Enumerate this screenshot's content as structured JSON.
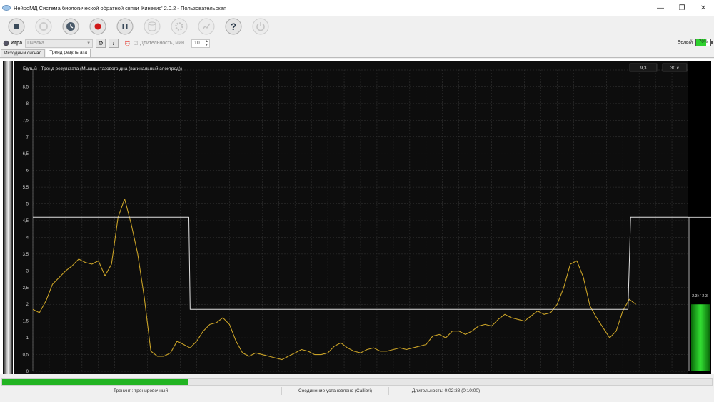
{
  "window": {
    "title": "НейроМД Система биологической обратной связи 'Кинезис' 2.0.2 - Пользовательская",
    "minimize": "—",
    "restore": "❐",
    "close": "✕"
  },
  "toolbar": {
    "buttons": [
      {
        "name": "stop",
        "icon": "stop-icon"
      },
      {
        "name": "disabled-record",
        "icon": "disc-icon"
      },
      {
        "name": "timer",
        "icon": "clock-icon"
      },
      {
        "name": "record",
        "icon": "record-icon"
      },
      {
        "name": "pause",
        "icon": "pause-icon"
      },
      {
        "name": "database",
        "icon": "database-icon"
      },
      {
        "name": "settings",
        "icon": "gear-icon"
      },
      {
        "name": "chart",
        "icon": "chart-icon"
      },
      {
        "name": "help",
        "icon": "help-icon",
        "label": "?"
      },
      {
        "name": "power",
        "icon": "power-icon"
      }
    ]
  },
  "options": {
    "game_label": "Игра",
    "game_value": "Пчёлка",
    "info_label": "i",
    "duration_label": "Длительность, мин.",
    "duration_value": "10",
    "user_label": "Белый",
    "battery_percent": "70%",
    "battery_level": 0.7
  },
  "tabs": [
    {
      "label": "Исходный сигнал",
      "active": false
    },
    {
      "label": "Тренд результата",
      "active": true
    }
  ],
  "plot": {
    "title": "Белый - Тренд результата (Мышцы тазового дна (вагинальный электрод))",
    "readout_value": "9,3",
    "readout_time": "30 с",
    "range_label": "2.3+/-2.3",
    "meter_level": 2.0
  },
  "chart_data": {
    "type": "line",
    "ylim": [
      0,
      9
    ],
    "xlim": [
      0,
      100
    ],
    "yticks": [
      "0",
      "0,5",
      "1",
      "1,5",
      "2",
      "2,5",
      "3",
      "3,5",
      "4",
      "4,5",
      "5",
      "5,5",
      "6",
      "6,5",
      "7",
      "7,5",
      "8",
      "8,5",
      "9"
    ],
    "series": [
      {
        "color": "#c9a227",
        "values": [
          [
            0,
            1.85
          ],
          [
            1,
            1.75
          ],
          [
            2,
            2.1
          ],
          [
            3,
            2.6
          ],
          [
            5,
            3.0
          ],
          [
            6,
            3.15
          ],
          [
            7,
            3.35
          ],
          [
            8,
            3.25
          ],
          [
            9,
            3.2
          ],
          [
            10,
            3.3
          ],
          [
            11,
            2.85
          ],
          [
            12,
            3.2
          ],
          [
            13,
            4.6
          ],
          [
            14,
            5.15
          ],
          [
            15,
            4.4
          ],
          [
            16,
            3.5
          ],
          [
            17,
            2.2
          ],
          [
            18,
            0.6
          ],
          [
            19,
            0.45
          ],
          [
            20,
            0.45
          ],
          [
            21,
            0.55
          ],
          [
            22,
            0.9
          ],
          [
            23,
            0.8
          ],
          [
            24,
            0.7
          ],
          [
            25,
            0.9
          ],
          [
            26,
            1.2
          ],
          [
            27,
            1.4
          ],
          [
            28,
            1.45
          ],
          [
            29,
            1.6
          ],
          [
            30,
            1.4
          ],
          [
            31,
            0.9
          ],
          [
            32,
            0.55
          ],
          [
            33,
            0.45
          ],
          [
            34,
            0.55
          ],
          [
            35,
            0.5
          ],
          [
            36,
            0.45
          ],
          [
            37,
            0.4
          ],
          [
            38,
            0.35
          ],
          [
            39,
            0.45
          ],
          [
            40,
            0.55
          ],
          [
            41,
            0.65
          ],
          [
            42,
            0.6
          ],
          [
            43,
            0.5
          ],
          [
            44,
            0.5
          ],
          [
            45,
            0.55
          ],
          [
            46,
            0.75
          ],
          [
            47,
            0.85
          ],
          [
            48,
            0.7
          ],
          [
            49,
            0.6
          ],
          [
            50,
            0.55
          ],
          [
            51,
            0.65
          ],
          [
            52,
            0.7
          ],
          [
            53,
            0.6
          ],
          [
            54,
            0.6
          ],
          [
            55,
            0.65
          ],
          [
            56,
            0.7
          ],
          [
            57,
            0.65
          ],
          [
            58,
            0.7
          ],
          [
            59,
            0.75
          ],
          [
            60,
            0.8
          ],
          [
            61,
            1.05
          ],
          [
            62,
            1.1
          ],
          [
            63,
            1.0
          ],
          [
            64,
            1.2
          ],
          [
            65,
            1.2
          ],
          [
            66,
            1.1
          ],
          [
            67,
            1.2
          ],
          [
            68,
            1.35
          ],
          [
            69,
            1.4
          ],
          [
            70,
            1.35
          ],
          [
            71,
            1.55
          ],
          [
            72,
            1.7
          ],
          [
            73,
            1.6
          ],
          [
            74,
            1.55
          ],
          [
            75,
            1.5
          ],
          [
            76,
            1.65
          ],
          [
            77,
            1.8
          ],
          [
            78,
            1.7
          ],
          [
            79,
            1.75
          ],
          [
            80,
            2.0
          ],
          [
            81,
            2.5
          ],
          [
            82,
            3.2
          ],
          [
            83,
            3.3
          ],
          [
            84,
            2.8
          ],
          [
            85,
            1.95
          ],
          [
            86,
            1.6
          ],
          [
            87,
            1.3
          ],
          [
            88,
            1.0
          ],
          [
            89,
            1.2
          ],
          [
            90,
            1.8
          ],
          [
            91,
            2.15
          ],
          [
            92,
            2.0
          ]
        ]
      },
      {
        "color": "#e0e0e0",
        "values": [
          [
            0,
            4.6
          ],
          [
            23.8,
            4.6
          ],
          [
            24,
            1.85
          ],
          [
            90.8,
            1.85
          ],
          [
            91.2,
            4.6
          ],
          [
            100,
            4.6
          ]
        ]
      }
    ]
  },
  "progress": {
    "fraction": 0.263
  },
  "status": {
    "training": "Тренинг : тренировочный",
    "connection": "Соединение установлено (Callibri)",
    "duration": "Длительность: 0:02:38 (0:10:00)"
  }
}
